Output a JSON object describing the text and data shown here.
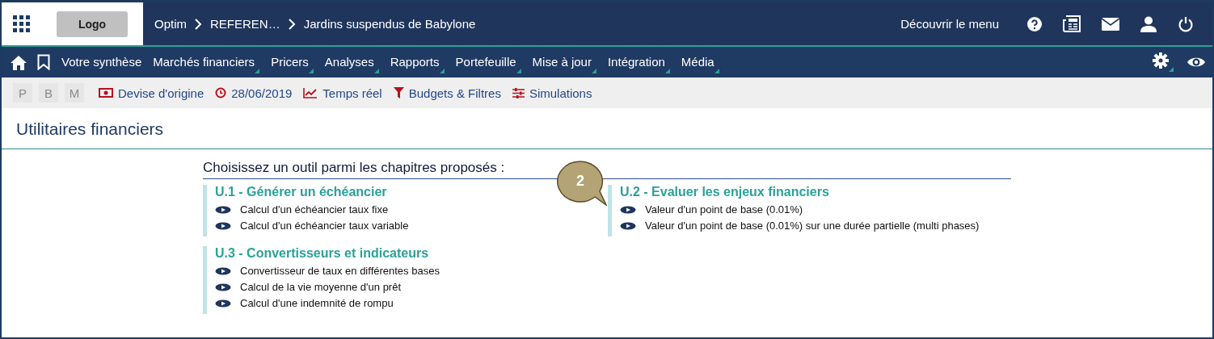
{
  "header": {
    "logo": "Logo",
    "breadcrumb": [
      "Optim",
      "REFEREN…",
      "Jardins suspendus de Babylone"
    ],
    "discover": "Découvrir le menu"
  },
  "nav": {
    "items": [
      {
        "label": "Votre synthèse",
        "has_menu": false
      },
      {
        "label": "Marchés financiers",
        "has_menu": true
      },
      {
        "label": "Pricers",
        "has_menu": true
      },
      {
        "label": "Analyses",
        "has_menu": true
      },
      {
        "label": "Rapports",
        "has_menu": true
      },
      {
        "label": "Portefeuille",
        "has_menu": true
      },
      {
        "label": "Mise à jour",
        "has_menu": true
      },
      {
        "label": "Intégration",
        "has_menu": true
      },
      {
        "label": "Média",
        "has_menu": true
      }
    ]
  },
  "toolbar": {
    "mode_buttons": [
      {
        "label": "P",
        "disabled": true
      },
      {
        "label": "B",
        "disabled": true
      },
      {
        "label": "M",
        "disabled": true
      }
    ],
    "actions": [
      {
        "kind": "currency",
        "label": "Devise d'origine"
      },
      {
        "kind": "date",
        "label": "28/06/2019"
      },
      {
        "kind": "realtime",
        "label": "Temps réel"
      },
      {
        "kind": "filter",
        "label": "Budgets & Filtres"
      },
      {
        "kind": "simulation",
        "label": "Simulations"
      }
    ]
  },
  "page": {
    "title": "Utilitaires financiers",
    "prompt": "Choisissez un outil parmi les chapitres proposés :",
    "sections": [
      {
        "title": "U.1 - Générer un échéancier",
        "items": [
          "Calcul d'un échéancier taux fixe",
          "Calcul d'un échéancier taux variable"
        ]
      },
      {
        "title": "U.2 - Evaluer les enjeux financiers",
        "items": [
          "Valeur d'un point de base (0.01%)",
          "Valeur d'un point de base (0.01%) sur une durée partielle (multi phases)"
        ]
      },
      {
        "title": "U.3 - Convertisseurs et indicateurs",
        "items": [
          "Convertisseur de taux en différentes bases",
          "Calcul de la vie moyenne d'un prêt",
          "Calcul d'une indemnité de rompu"
        ]
      }
    ],
    "callout": "2"
  }
}
